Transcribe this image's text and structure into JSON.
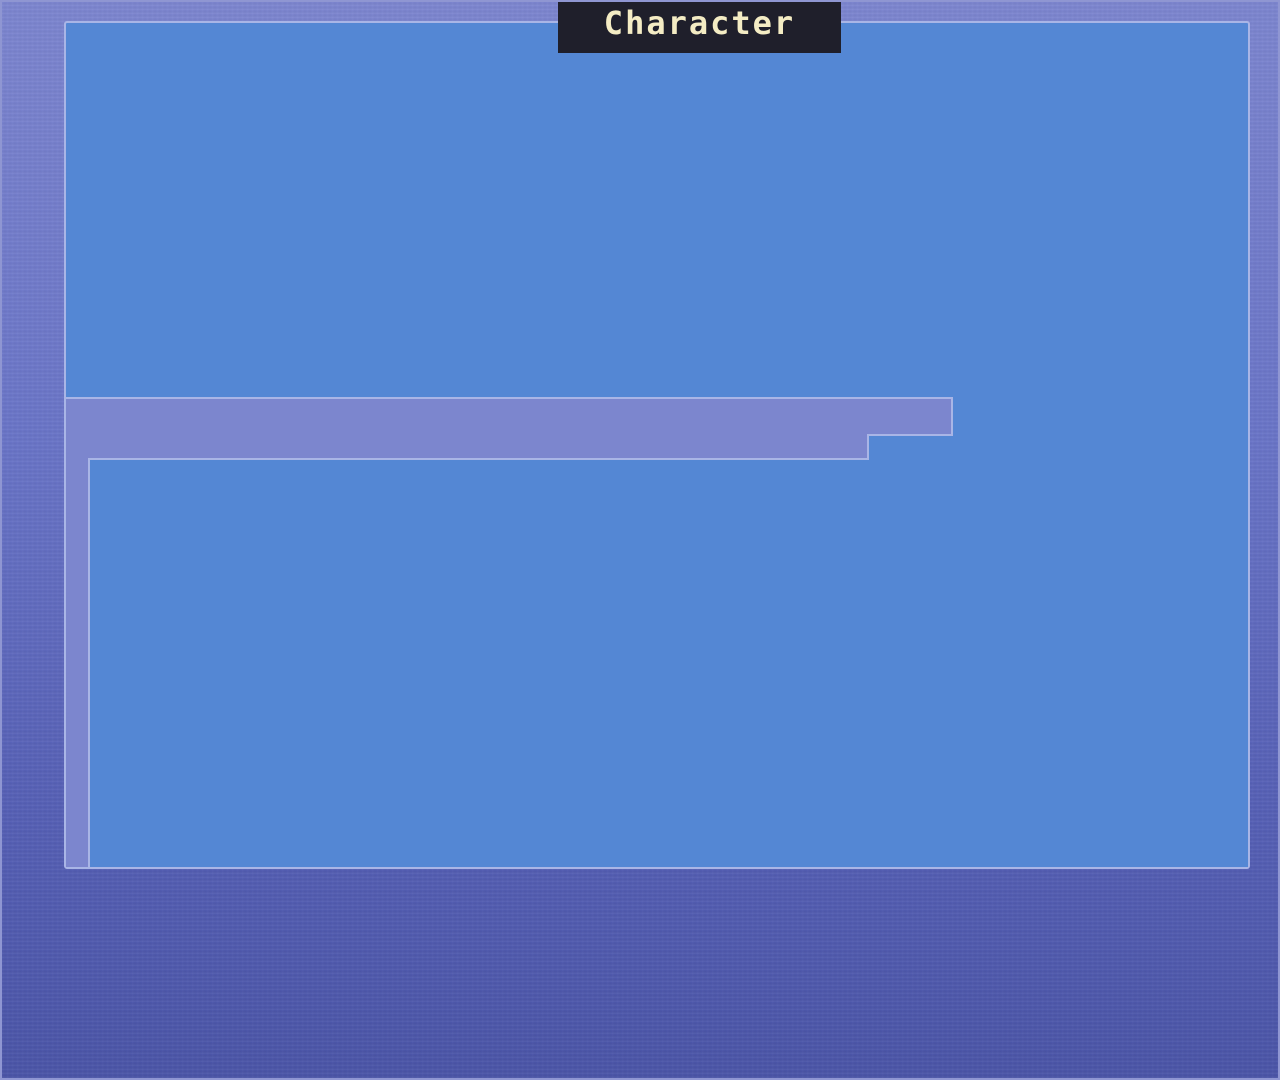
{
  "window": {
    "title": "Character"
  },
  "colors": {
    "background_top": "#7d86d0",
    "background_bottom": "#4b55a8",
    "panel_fill": "#5487d4",
    "panel_border": "#a9b5e6",
    "frame_fill": "#7c86ce",
    "title_tab_bg": "#1f1f2b",
    "title_text": "#f4ecc4"
  }
}
